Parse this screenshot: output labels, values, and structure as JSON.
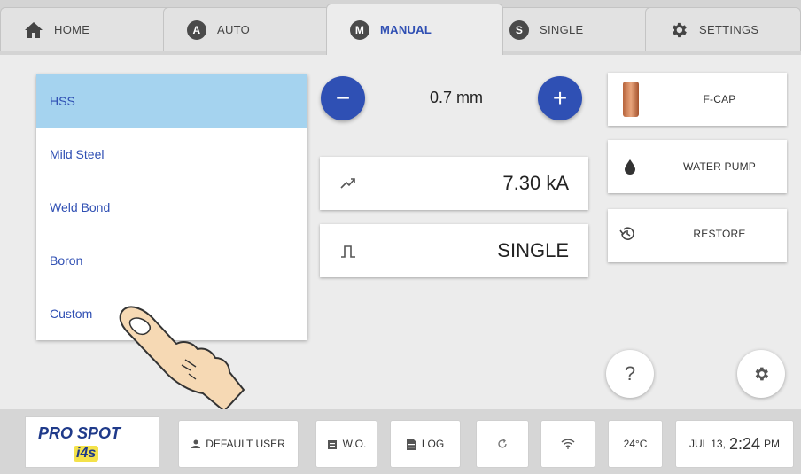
{
  "tabs": [
    {
      "label": "HOME",
      "icon": "home-icon"
    },
    {
      "label": "AUTO",
      "badge": "A"
    },
    {
      "label": "MANUAL",
      "badge": "M",
      "active": true
    },
    {
      "label": "SINGLE",
      "badge": "S"
    },
    {
      "label": "SETTINGS",
      "icon": "gear-icon"
    }
  ],
  "materials": [
    "HSS",
    "Mild Steel",
    "Weld Bond",
    "Boron",
    "Custom"
  ],
  "selected_material": "HSS",
  "thickness": {
    "value": "0.7 mm",
    "decrease_label": "−",
    "increase_label": "+"
  },
  "current": {
    "value": "7.30 kA",
    "icon": "trend-icon"
  },
  "pulse": {
    "value": "SINGLE",
    "icon": "pulse-icon"
  },
  "side_buttons": {
    "fcap": "F-CAP",
    "water_pump": "WATER PUMP",
    "restore": "RESTORE"
  },
  "help_label": "?",
  "bottom": {
    "brand": "PRO SPOT",
    "brand_sub": "i4s",
    "user": "DEFAULT USER",
    "wo": "W.O.",
    "log": "LOG",
    "temperature": "24°C",
    "date": "JUL 13,",
    "time": "2:24",
    "ampm": "PM"
  },
  "colors": {
    "accent": "#2f50b4",
    "selected_row": "#a5d3ef",
    "text_blue": "#2f4fb3"
  }
}
